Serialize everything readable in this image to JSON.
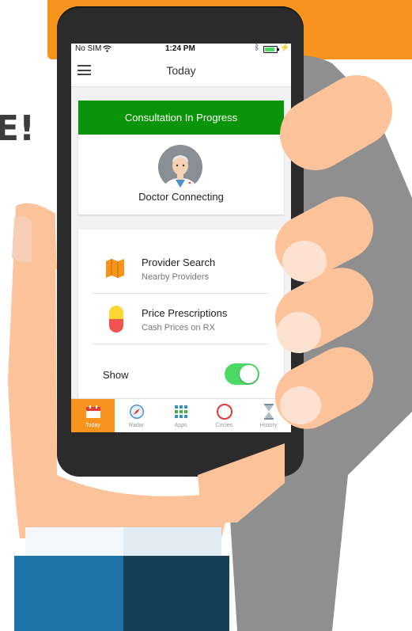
{
  "headline": "E!",
  "status_bar": {
    "carrier": "No SIM",
    "wifi_icon": "wifi-icon",
    "time": "1:24 PM",
    "bluetooth_icon": "bluetooth-icon",
    "battery_level": 0.85
  },
  "nav": {
    "title": "Today",
    "menu_icon": "hamburger-menu-icon"
  },
  "consultation": {
    "banner": "Consultation In Progress",
    "status": "Doctor Connecting",
    "banner_color": "#0a9409"
  },
  "features": [
    {
      "title": "Provider Search",
      "subtitle": "Nearby Providers",
      "icon": "map-icon"
    },
    {
      "title": "Price Prescriptions",
      "subtitle": "Cash Prices on RX",
      "icon": "pill-icon"
    }
  ],
  "show_toggle": {
    "label": "Show",
    "on": true
  },
  "tabs": [
    {
      "label": "Today",
      "icon": "calendar-icon",
      "active": true
    },
    {
      "label": "Radar",
      "icon": "compass-icon",
      "active": false
    },
    {
      "label": "Apps",
      "icon": "apps-grid-icon",
      "active": false
    },
    {
      "label": "Circles",
      "icon": "circle-icon",
      "active": false
    },
    {
      "label": "History",
      "icon": "hourglass-icon",
      "active": false
    }
  ],
  "colors": {
    "accent_orange": "#f7941d",
    "toggle_green": "#4cd964",
    "skin": "#fcc39b"
  }
}
